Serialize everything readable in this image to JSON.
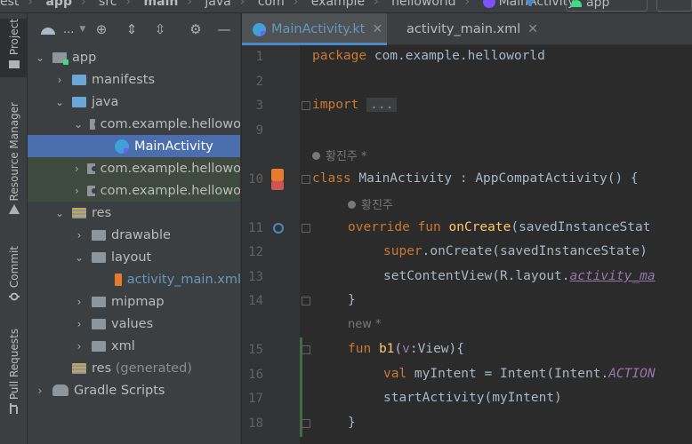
{
  "breadcrumb": {
    "items": [
      "est",
      "app",
      "src",
      "main",
      "java",
      "com",
      "example",
      "helloworld",
      "MainActivity"
    ],
    "run_config": "app"
  },
  "left_strip": {
    "tabs": [
      "Project",
      "Resource Manager",
      "Commit",
      "Pull Requests"
    ]
  },
  "project_panel": {
    "view_label": "...",
    "tree": [
      {
        "label": "app",
        "level": 0,
        "expanded": true
      },
      {
        "label": "manifests",
        "level": 1,
        "expanded": false
      },
      {
        "label": "java",
        "level": 1,
        "expanded": true
      },
      {
        "label": "com.example.hellowo",
        "level": 2,
        "expanded": true
      },
      {
        "label": "MainActivity",
        "level": 3,
        "selected": true
      },
      {
        "label": "com.example.hellowo",
        "level": 2,
        "expanded": false
      },
      {
        "label": "com.example.hellowo",
        "level": 2,
        "expanded": false
      },
      {
        "label": "res",
        "level": 1,
        "expanded": true
      },
      {
        "label": "drawable",
        "level": 2,
        "expanded": false
      },
      {
        "label": "layout",
        "level": 2,
        "expanded": true
      },
      {
        "label": "activity_main.xml",
        "level": 3
      },
      {
        "label": "mipmap",
        "level": 2,
        "expanded": false
      },
      {
        "label": "values",
        "level": 2,
        "expanded": false
      },
      {
        "label": "xml",
        "level": 2,
        "expanded": false
      },
      {
        "label": "res",
        "suffix": "(generated)",
        "level": 1
      },
      {
        "label": "Gradle Scripts",
        "level": 0,
        "expanded": false
      }
    ]
  },
  "editor": {
    "tabs": [
      {
        "label": "MainActivity.kt",
        "active": true
      },
      {
        "label": "activity_main.xml",
        "active": false
      }
    ],
    "lines": {
      "l1": {
        "num": "1",
        "kw": "package",
        "rest": " com.example.helloworld"
      },
      "l2": {
        "num": "2"
      },
      "l3": {
        "num": "3",
        "kw": "import",
        "folded": "..."
      },
      "l9": {
        "num": "9"
      },
      "author1": "황진주 *",
      "l10": {
        "num": "10",
        "kw": "class",
        "rest": " MainActivity : AppCompatActivity() {"
      },
      "author2": "황진주",
      "l11": {
        "num": "11",
        "kw": "override fun",
        "fn": "onCreate",
        "rest": "(savedInstanceStat"
      },
      "l12": {
        "num": "12",
        "kw": "super",
        "rest": ".onCreate(savedInstanceState)"
      },
      "l13": {
        "num": "13",
        "pre": "setContentView(R.layout.",
        "italic": "activity_ma"
      },
      "l14": {
        "num": "14",
        "rest": "}"
      },
      "new_hint": "new *",
      "l15": {
        "num": "15",
        "kw": "fun",
        "fn": "b1",
        "param": "v",
        "rest": ":View){"
      },
      "l16": {
        "num": "16",
        "kw": "val",
        "rest": " myIntent = Intent(Intent.",
        "italic": "ACTION"
      },
      "l17": {
        "num": "17",
        "rest": "startActivity(myIntent)"
      },
      "l18": {
        "num": "18",
        "rest": "}"
      }
    }
  }
}
